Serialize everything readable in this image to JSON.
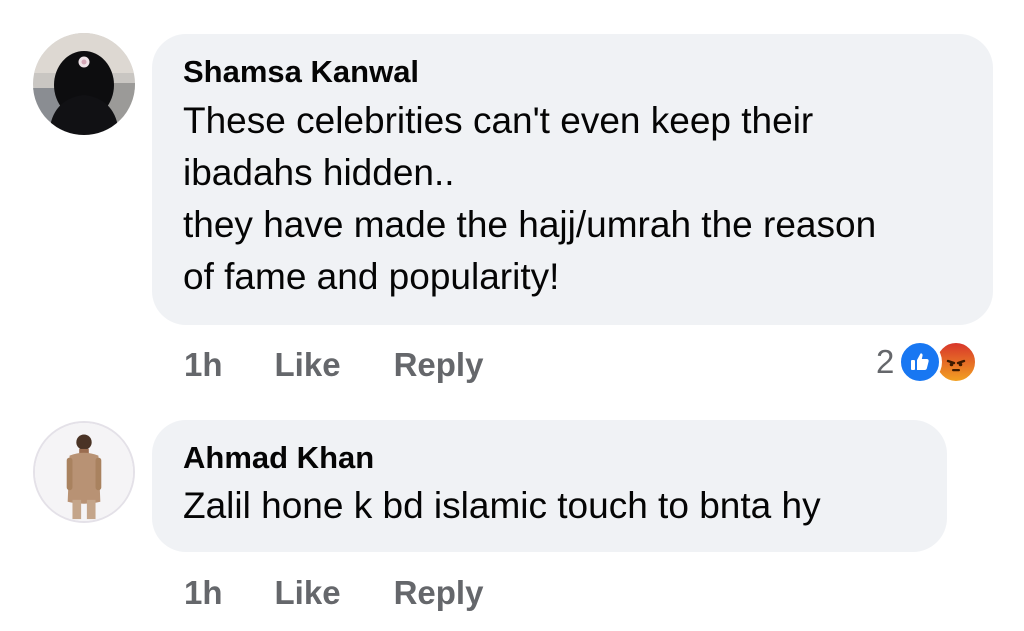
{
  "comments": [
    {
      "author": "Shamsa Kanwal",
      "lines": [
        "These celebrities can't even keep their",
        "ibadahs hidden..",
        "they have made the hajj/umrah the reason",
        "of fame and popularity!"
      ],
      "timestamp": "1h",
      "like_label": "Like",
      "reply_label": "Reply",
      "reaction_count": "2",
      "reaction_icons": [
        "like-icon",
        "angry-icon"
      ]
    },
    {
      "author": "Ahmad Khan",
      "lines": [
        "Zalil hone k bd islamic touch to bnta hy"
      ],
      "timestamp": "1h",
      "like_label": "Like",
      "reply_label": "Reply"
    }
  ],
  "colors": {
    "bubble_bg": "#f0f2f5",
    "text": "#050505",
    "secondary_text": "#65676b",
    "like_blue": "#1877f2",
    "angry_orange": "#e9710f"
  }
}
